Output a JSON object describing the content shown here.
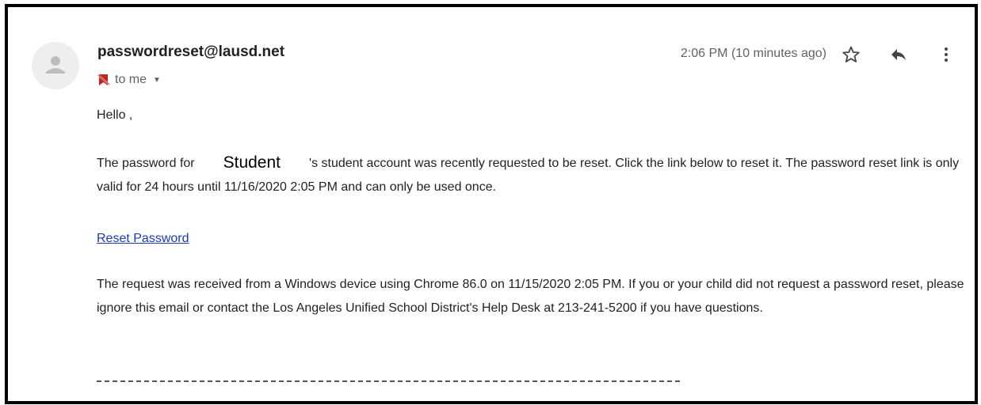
{
  "email": {
    "sender": "passwordreset@lausd.net",
    "recipient": "to me",
    "timestamp": "2:06 PM (10 minutes ago)",
    "greeting": "Hello ,",
    "student_name": "Student",
    "paragraph1_before": "The password for",
    "paragraph1_after": "'s student account was recently requested to be reset. Click the link below to reset it. The password reset link is only valid for 24 hours until 11/16/2020 2:05 PM and can only be used once.",
    "link_text": "Reset Password",
    "paragraph2": "The request was received from a Windows device using Chrome 86.0 on 11/15/2020 2:05 PM. If you or your child did not request a password reset, please ignore this email or contact the Los Angeles Unified School District's Help Desk at 213-241-5200 if you have questions.",
    "signature_divider": "-----------------------------------------------------------------------------------------------------------------"
  },
  "icons": {
    "avatar": "person-icon",
    "recipient_label": "label-icon",
    "recipient_dropdown": "chevron-down-icon",
    "star": "star-icon",
    "reply": "reply-icon",
    "more": "more-vert-icon"
  },
  "colors": {
    "link": "#1a3ab8",
    "secondary_text": "#5f6368",
    "frame_border": "#000000",
    "label_icon": "#c5221f"
  }
}
